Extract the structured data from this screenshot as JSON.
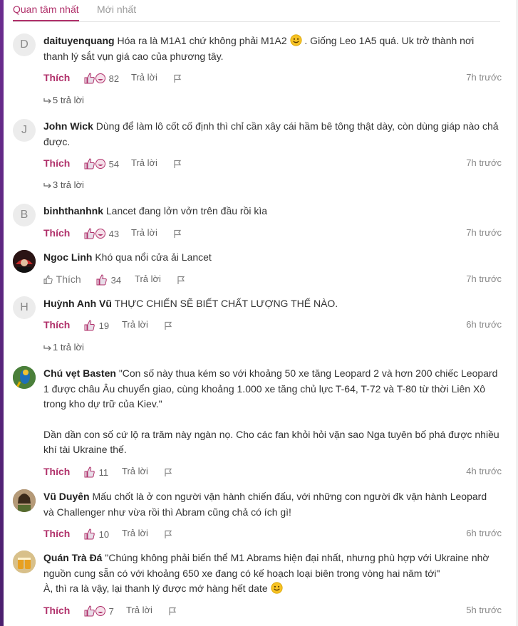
{
  "tabs": {
    "active": "Quan tâm nhất",
    "inactive": "Mới nhất"
  },
  "like_label": "Thích",
  "reply_label": "Trả lời",
  "comments": [
    {
      "avatar_letter": "D",
      "author": "daituyenquang",
      "text": "Hóa ra là M1A1 chứ không phải M1A2",
      "text_after_emoji": ". Giống Leo 1A5 quá. Uk trở thành nơi thanh lý sắt vụn giá cao của phương tây.",
      "likes": "82",
      "time": "7h trước",
      "replies": "5 trả lời"
    },
    {
      "avatar_letter": "J",
      "author": "John Wick",
      "text": "Dùng để làm lô cốt cố định thì chỉ cần xây cái hầm bê tông thật dày, còn dùng giáp nào chả được.",
      "likes": "54",
      "time": "7h trước",
      "replies": "3 trả lời"
    },
    {
      "avatar_letter": "B",
      "author": "binhthanhnk",
      "text": "Lancet đang lởn vởn trên đầu rồi kìa",
      "likes": "43",
      "time": "7h trước"
    },
    {
      "author": "Ngoc Linh",
      "text": "Khó qua nổi cửa ải Lancet",
      "likes": "34",
      "time": "7h trước"
    },
    {
      "avatar_letter": "H",
      "author": "Huỳnh Anh Vũ",
      "text": "THỰC CHIẾN SẼ BIẾT CHẤT LƯỢNG THẾ NÀO.",
      "likes": "19",
      "time": "6h trước",
      "replies": "1 trả lời"
    },
    {
      "author": "Chú vẹt Basten",
      "text": "\"Con số này thua kém so với khoảng 50 xe tăng Leopard 2 và hơn 200 chiếc Leopard 1 được châu Âu chuyển giao, cùng khoảng 1.000 xe tăng chủ lực T-64, T-72 và T-80 từ thời Liên Xô trong kho dự trữ của Kiev.\"",
      "text2": "Dần dần con số cứ lộ ra trăm này ngàn nọ. Cho các fan khỏi hỏi vặn sao Nga tuyên bố phá được nhiều khí tài Ukraine thế.",
      "likes": "11",
      "time": "4h trước"
    },
    {
      "author": "Vũ Duyên",
      "text": "Mấu chốt là ở con người vận hành chiến đấu, với những con người đk vận hành Leopard và Challenger như vừa rồi thì Abram cũng chả có ích gì!",
      "likes": "10",
      "time": "6h trước"
    },
    {
      "author": "Quán Trà Đá",
      "text": "\"Chúng không phải biến thể M1 Abrams hiện đại nhất, nhưng phù hợp với Ukraine nhờ nguồn cung sẵn có với khoảng 650 xe đang có kế hoạch loại biên trong vòng hai năm tới\"",
      "text2": "À, thì ra là vậy, lại thanh lý được mớ hàng hết date",
      "likes": "7",
      "time": "5h trước"
    }
  ]
}
